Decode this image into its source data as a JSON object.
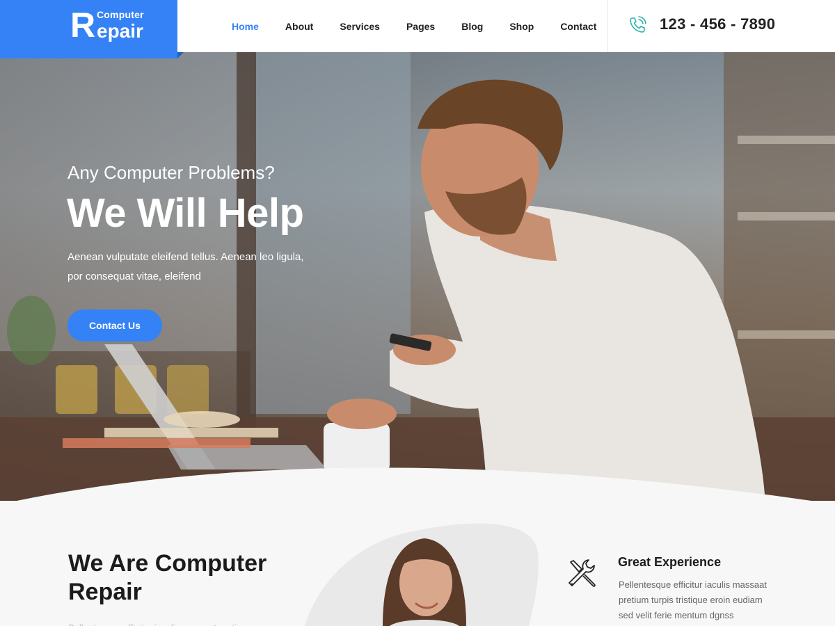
{
  "logo": {
    "letter": "R",
    "small": "Computer",
    "big": "epair"
  },
  "nav": {
    "items": [
      {
        "label": "Home",
        "active": true
      },
      {
        "label": "About"
      },
      {
        "label": "Services"
      },
      {
        "label": "Pages"
      },
      {
        "label": "Blog"
      },
      {
        "label": "Shop"
      },
      {
        "label": "Contact"
      }
    ]
  },
  "contact": {
    "phone": "123 - 456 - 7890",
    "icon": "phone-icon"
  },
  "hero": {
    "subtitle": "Any Computer Problems?",
    "title": "We Will Help",
    "text": "Aenean vulputate eleifend tellus. Aenean leo ligula, por consequat vitae, eleifend",
    "button": "Contact Us"
  },
  "about": {
    "title": "We Are Computer Repair",
    "partial_line": "Pellentesque efficitur iaculis massaat pretium"
  },
  "feature": {
    "icon": "tools-icon",
    "title": "Great Experience",
    "text": "Pellentesque efficitur iaculis massaat pretium turpis tristique eroin eudiam sed velit ferie mentum dgnss"
  },
  "colors": {
    "accent": "#3582f6",
    "text_dark": "#1b1b1b"
  }
}
